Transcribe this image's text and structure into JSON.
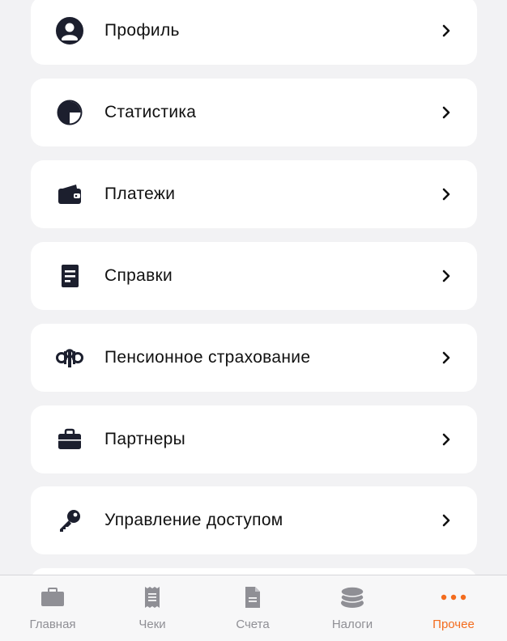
{
  "menu": {
    "items": [
      {
        "label": "Профиль",
        "icon": "profile-icon"
      },
      {
        "label": "Статистика",
        "icon": "pie-chart-icon"
      },
      {
        "label": "Платежи",
        "icon": "wallet-icon"
      },
      {
        "label": "Справки",
        "icon": "document-icon"
      },
      {
        "label": "Пенсионное страхование",
        "icon": "pension-fund-icon"
      },
      {
        "label": "Партнеры",
        "icon": "briefcase-icon"
      },
      {
        "label": "Управление доступом",
        "icon": "key-icon"
      }
    ],
    "chevron_icon": "chevron-right-icon"
  },
  "tabbar": {
    "tabs": [
      {
        "label": "Главная",
        "icon": "briefcase-icon",
        "active": false
      },
      {
        "label": "Чеки",
        "icon": "receipt-icon",
        "active": false
      },
      {
        "label": "Счета",
        "icon": "invoice-icon",
        "active": false
      },
      {
        "label": "Налоги",
        "icon": "coins-stack-icon",
        "active": false
      },
      {
        "label": "Прочее",
        "icon": "more-dots-icon",
        "active": true
      }
    ]
  },
  "colors": {
    "background": "#f2f2f4",
    "card": "#ffffff",
    "text": "#111111",
    "icon_dark": "#1c1f2e",
    "tab_inactive": "#8f8f95",
    "accent": "#f36c1e"
  }
}
